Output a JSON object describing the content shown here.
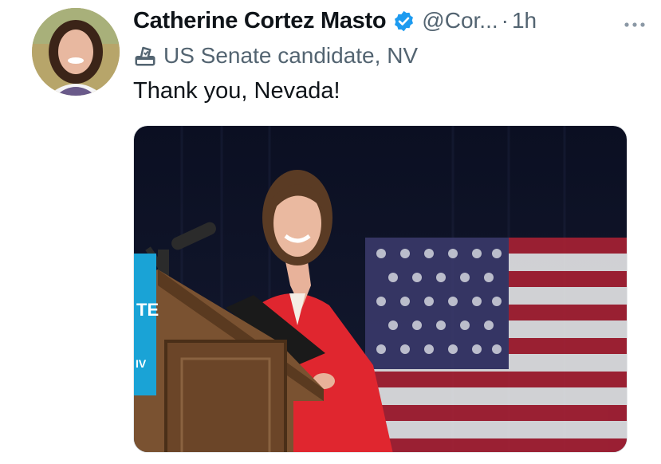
{
  "tweet": {
    "author_name": "Catherine Cortez Masto",
    "handle": "@Cor...",
    "separator": "·",
    "time": "1h",
    "label": "US Senate candidate, NV",
    "text": "Thank you, Nevada!"
  },
  "icons": {
    "verified": "verified-badge-icon",
    "label": "ballot-box-icon",
    "more": "more-options-icon"
  },
  "colors": {
    "verified_blue": "#1d9bf0",
    "secondary_text": "#536471"
  },
  "media": {
    "podium_sign_text": "TE",
    "podium_sign_text_2": "IV"
  }
}
